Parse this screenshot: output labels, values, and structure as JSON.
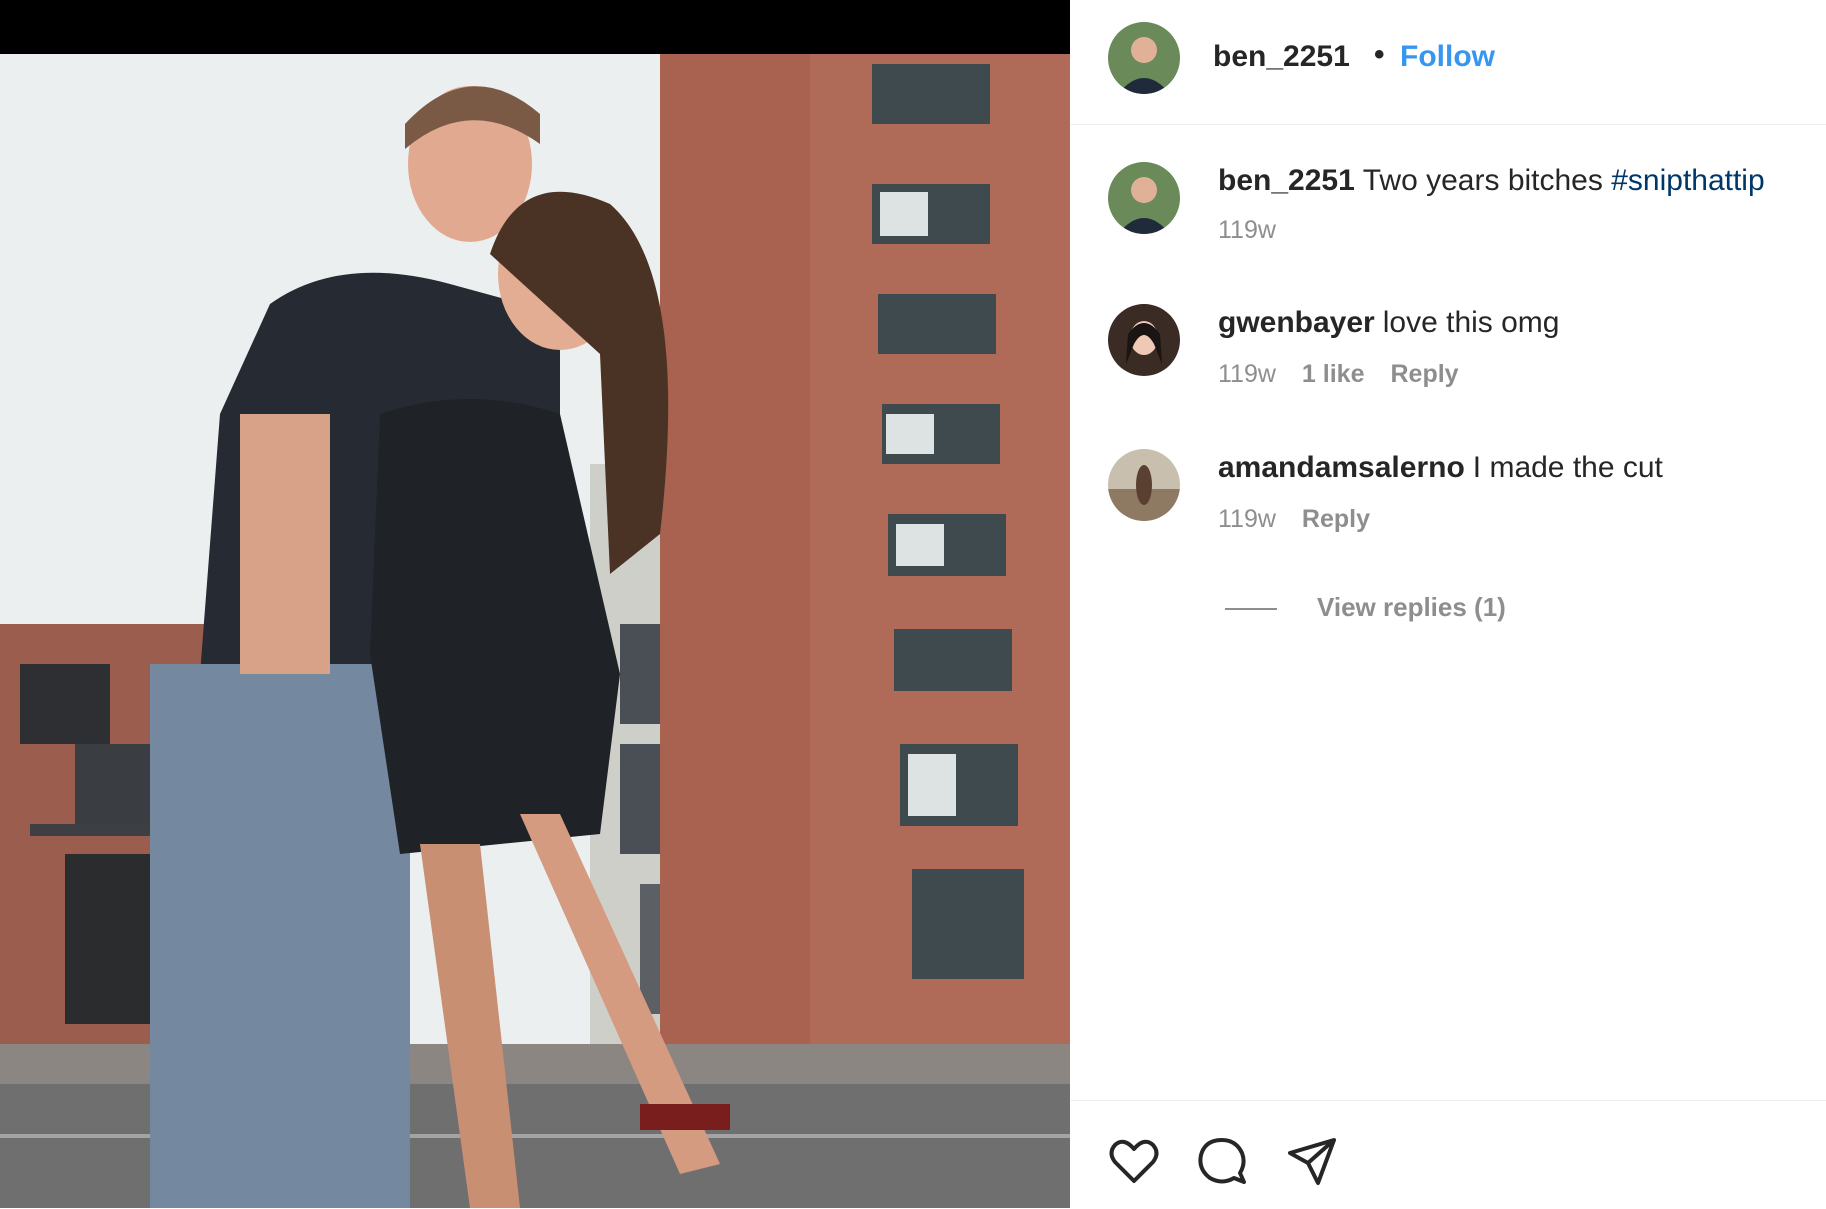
{
  "post": {
    "photo_alt": "",
    "header": {
      "username": "ben_2251",
      "separator": "•",
      "follow_label": "Follow"
    },
    "caption": {
      "username": "ben_2251",
      "text": "Two years bitches",
      "hashtag": "#snipthattip",
      "time": "119w"
    },
    "comments": [
      {
        "username": "gwenbayer",
        "text": "love this omg",
        "time": "119w",
        "likes": "1 like",
        "reply_label": "Reply"
      },
      {
        "username": "amandamsalerno",
        "text": "I made the cut",
        "time": "119w",
        "reply_label": "Reply"
      }
    ],
    "view_replies_label": "View replies (1)",
    "actions": {
      "like_icon": "heart-icon",
      "comment_icon": "comment-bubble-icon",
      "share_icon": "paper-plane-icon"
    }
  },
  "colors": {
    "link_blue": "#3797f0",
    "hashtag_blue": "#00376b",
    "muted": "#8e8e8e"
  }
}
